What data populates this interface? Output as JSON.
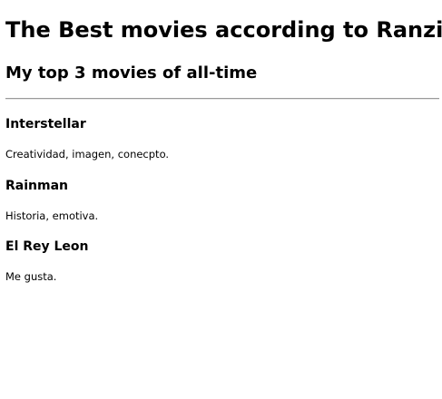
{
  "page": {
    "title": "The Best movies according to Ranzik",
    "subtitle": "My top 3 movies of all-time"
  },
  "movies": [
    {
      "title": "Interstellar",
      "description": "Creatividad, imagen, conecpto."
    },
    {
      "title": "Rainman",
      "description": "Historia, emotiva."
    },
    {
      "title": "El Rey Leon",
      "description": "Me gusta."
    }
  ]
}
